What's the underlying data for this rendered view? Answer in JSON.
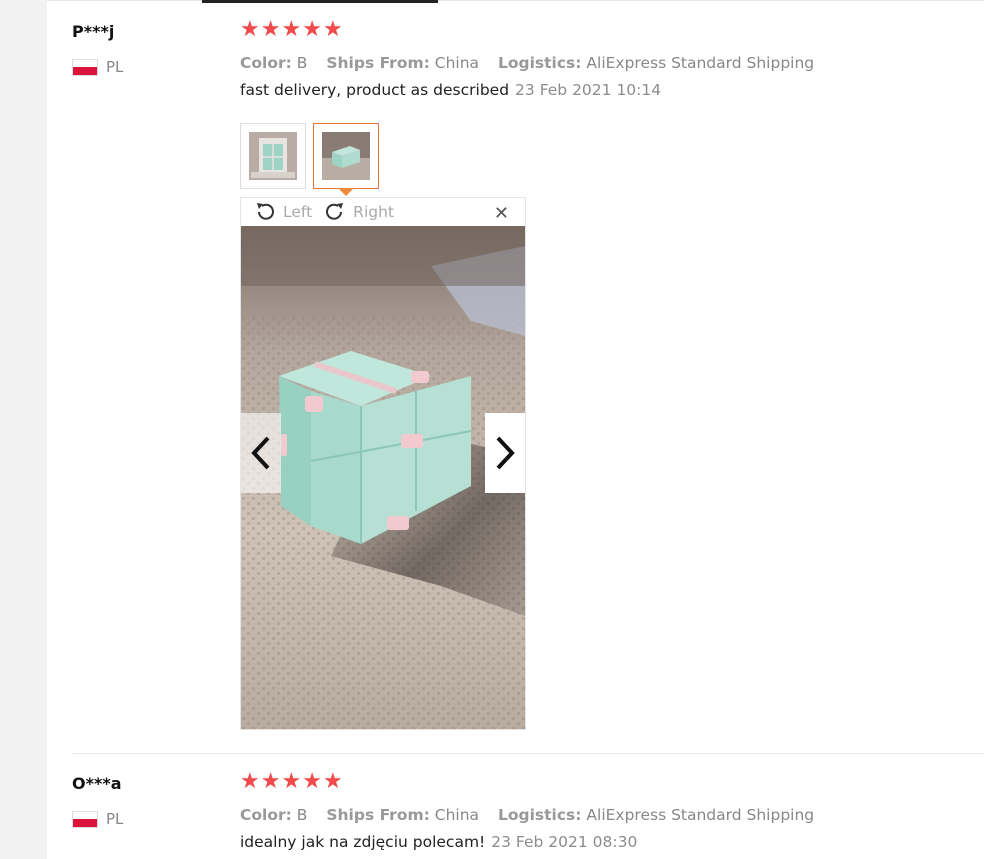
{
  "reviews": [
    {
      "user": "P***j",
      "country": "PL",
      "rating": 5,
      "color_label": "Color:",
      "color_value": "B",
      "ships_label": "Ships From:",
      "ships_value": "China",
      "logistics_label": "Logistics:",
      "logistics_value": "AliExpress Standard Shipping",
      "text": "fast delivery, product as described",
      "date": "23 Feb 2021 10:14"
    },
    {
      "user": "O***a",
      "country": "PL",
      "rating": 5,
      "color_label": "Color:",
      "color_value": "B",
      "ships_label": "Ships From:",
      "ships_value": "China",
      "logistics_label": "Logistics:",
      "logistics_value": "AliExpress Standard Shipping",
      "text": "idealny jak na zdjęciu polecam!",
      "date": "23 Feb 2021 08:30"
    }
  ],
  "viewer": {
    "rotate_left": "Left",
    "rotate_right": "Right",
    "close_symbol": "✕"
  },
  "colors": {
    "star": "#f04a4a",
    "active_thumb": "#e8743b",
    "flag_red": "#dc143c"
  },
  "icons": [
    "star-icon",
    "rotate-left-icon",
    "rotate-right-icon",
    "close-icon",
    "chevron-left-icon",
    "chevron-right-icon",
    "flag-pl-icon"
  ]
}
